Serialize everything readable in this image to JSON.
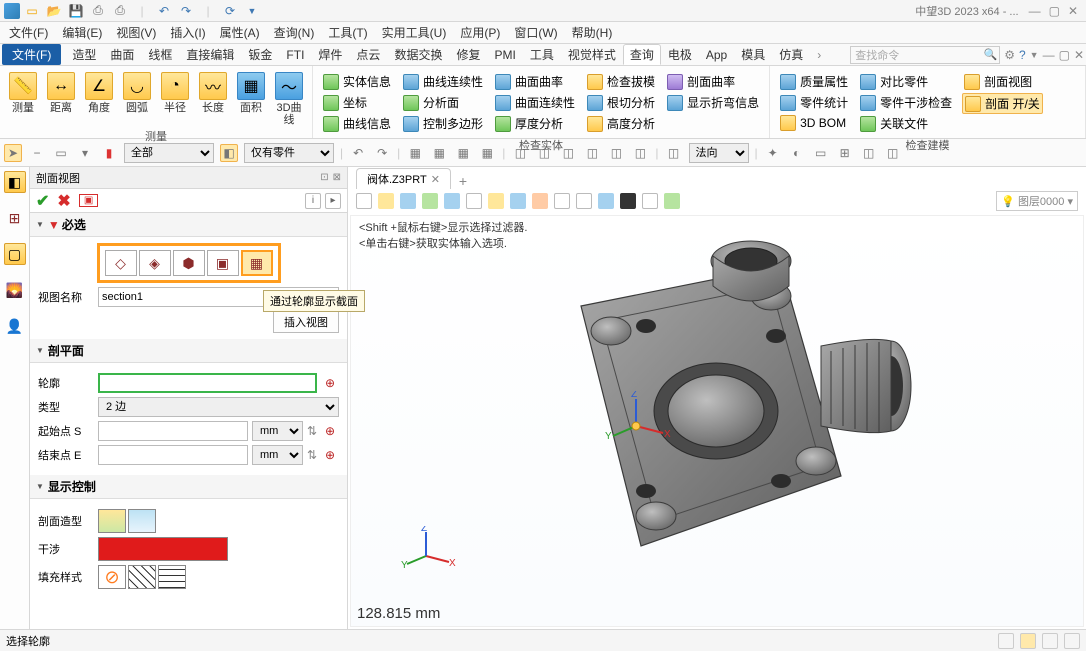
{
  "app_title": "中望3D 2023 x64 - ...",
  "menus": {
    "file": "文件(F)",
    "edit": "编辑(E)",
    "view": "视图(V)",
    "insert": "插入(I)",
    "attr": "属性(A)",
    "query": "查询(N)",
    "tool": "工具(T)",
    "util": "实用工具(U)",
    "app": "应用(P)",
    "window": "窗口(W)",
    "help": "帮助(H)"
  },
  "search_placeholder": "查找命令",
  "file_btn": "文件(F)",
  "tabs": {
    "shape": "造型",
    "surf": "曲面",
    "wire": "线框",
    "dedit": "直接编辑",
    "sheet": "钣金",
    "fti": "FTI",
    "weld": "焊件",
    "pcl": "点云",
    "dex": "数据交换",
    "repair": "修复",
    "pmi": "PMI",
    "tools": "工具",
    "vstyle": "视觉样式",
    "query": "查询",
    "electrode": "电极",
    "app2": "App",
    "mold": "模具",
    "sim": "仿真"
  },
  "ribbon": {
    "group1": {
      "label": "测量",
      "items": {
        "measure": "测量",
        "dist": "距离",
        "ang": "角度",
        "arc": "圆弧",
        "rad": "半径",
        "len": "长度",
        "area": "面积",
        "curve3d": "3D曲线"
      }
    },
    "group2": {
      "label": "检查实体",
      "col1": {
        "a": "实体信息",
        "b": "坐标",
        "c": "曲线信息"
      },
      "col2": {
        "a": "曲线连续性",
        "b": "分析面",
        "c": "控制多边形"
      },
      "col3": {
        "a": "曲面曲率",
        "b": "曲面连续性",
        "c": "厚度分析"
      },
      "col4": {
        "a": "检查拔模",
        "b": "根切分析",
        "c": "高度分析"
      },
      "col5": {
        "a": "剖面曲率",
        "b": "显示折弯信息"
      }
    },
    "group3": {
      "label": "检查建模",
      "col1": {
        "a": "质量属性",
        "b": "零件统计",
        "c": "3D BOM"
      },
      "col2": {
        "a": "对比零件",
        "b": "零件干涉检查",
        "c": "关联文件"
      },
      "col3": {
        "a": "剖面视图",
        "b": "剖面 开/关"
      }
    }
  },
  "toolbar2": {
    "all": "全部",
    "onlyparts": "仅有零件",
    "dir": "法向"
  },
  "panel": {
    "title": "剖面视图",
    "sec_required": "必选",
    "view_name_label": "视图名称",
    "view_name_value": "section1",
    "insert_view": "插入视图",
    "sec_plane": "剖平面",
    "profile": "轮廓",
    "type": "类型",
    "type_value": "2 边",
    "start_s": "起始点 S",
    "end_e": "结束点 E",
    "unit": "mm",
    "sec_display": "显示控制",
    "section_style": "剖面造型",
    "interfere": "干涉",
    "fill_style": "填充样式"
  },
  "tooltip": "通过轮廓显示截面",
  "doc_tab": "阀体.Z3PRT",
  "layer": "图层0000",
  "hint1": "<Shift +鼠标右键>显示选择过滤器.",
  "hint2": "<单击右键>获取实体输入选项.",
  "dimension": "128.815 mm",
  "status": "选择轮廓"
}
